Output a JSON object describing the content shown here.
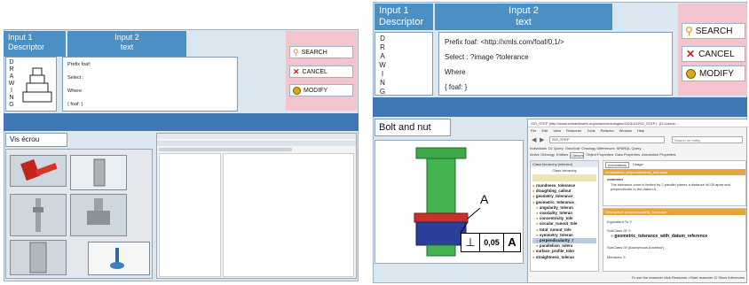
{
  "left": {
    "input1": {
      "title": "Input 1",
      "subtitle": "Descriptor"
    },
    "input2": {
      "title": "Input 2",
      "subtitle": "text"
    },
    "drawing_letters": [
      "D",
      "R",
      "A",
      "W",
      "I",
      "N",
      "G"
    ],
    "query_lines": [
      "Prefix foaf:",
      "Select :",
      "Where",
      "{ foaf: }"
    ],
    "buttons": {
      "search": "SEARCH",
      "cancel": "CANCEL",
      "modify": "MODIFY"
    },
    "section_title": "Vis écrou"
  },
  "right": {
    "input1": {
      "title": "Input 1",
      "subtitle": "Descriptor"
    },
    "input2": {
      "title": "Input 2",
      "subtitle": "text"
    },
    "drawing_letters": [
      "D",
      "R",
      "A",
      "W",
      "I",
      "N",
      "G"
    ],
    "query_lines": [
      "Prefix foaf: <http://xmls.com/foaf/0,1/>",
      "Select : ?image ?tolerance",
      "Where",
      "{ foaf: }"
    ],
    "buttons": {
      "search": "SEARCH",
      "cancel": "CANCEL",
      "modify": "MODIFY"
    },
    "section_title": "Bolt and nut",
    "annotation_letter": "A",
    "tolerance_symbol": "⊥",
    "tolerance_value": "0,05",
    "tolerance_ref": "A",
    "protege": {
      "window_title": "ISO_STEP (http://www.semanticweb.org/onseto/ontologies/2015/10/ISO_STEP) : [D:\\Users\\...",
      "menu": [
        "File",
        "Edit",
        "View",
        "Reasoner",
        "Tools",
        "Refactor",
        "Window",
        "Help"
      ],
      "ontology_name": "ISO_STEP",
      "search_placeholder": "Search for entity",
      "tabs_row1": [
        "Individuals",
        "DL Query",
        "OntoGraf",
        "Ontology Differences",
        "SPARQL Query"
      ],
      "tabs_row2": [
        "Active Ontology",
        "Entities",
        "Classes",
        "Object Properties",
        "Data Properties",
        "Annotation Properties"
      ],
      "left_header": "Class hierarchy (inferred)",
      "left_sub": "Class hierarchy",
      "class_items": [
        "roundness_tolerance",
        "draughting_callout",
        "geometry_tolerance_",
        "geometric_tolerance_",
        "angularity_toleran",
        "coaxiality_toleran",
        "concentricity_tole",
        "circular_runout_tole",
        "total_runout_tole",
        "symmetry_toleran",
        "perpendicularity_t",
        "parallelism_tolera",
        "surface_profile_toler",
        "straightness_toleran"
      ],
      "annotations_tabs": [
        "Annotations",
        "Usage"
      ],
      "annotation_header": "Annotations: perpendicularity_tolerance",
      "comment_label": "comment",
      "comment_text": "The tolerance zone is limited by 2 parallel planes a distance h0.05 apart and perpendicular to the datum A",
      "description_header": "Description: perpendicularity_tolerance",
      "equivalent_to": "Equivalent To",
      "subclass_of": "SubClass Of",
      "subclass_value": "geometric_tolerance_with_datum_reference",
      "anonymous_ancestor": "SubClass Of (Anonymous Ancestor)",
      "members": "Members",
      "status_text": "To use the reasoner click Reasoner->Start reasoner",
      "show_inferences": "Show Inferences"
    }
  },
  "colors": {
    "header_blue": "#4a90c4",
    "strip_blue": "#3f78b5",
    "panel_bg": "#dbe7f0",
    "button_panel": "#f2c4cd",
    "bolt_green": "#3ea84a",
    "nut_red": "#c8322c"
  }
}
